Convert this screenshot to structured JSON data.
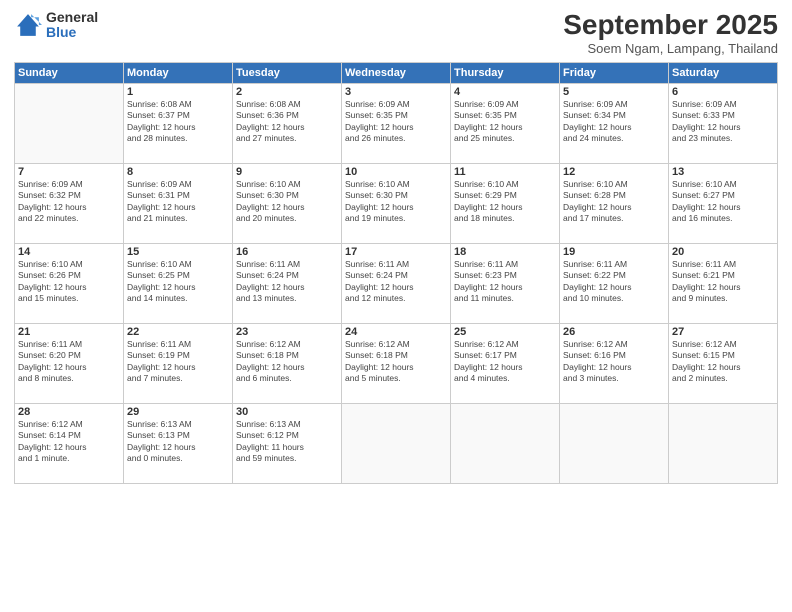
{
  "header": {
    "logo_general": "General",
    "logo_blue": "Blue",
    "title": "September 2025",
    "subtitle": "Soem Ngam, Lampang, Thailand"
  },
  "days_of_week": [
    "Sunday",
    "Monday",
    "Tuesday",
    "Wednesday",
    "Thursday",
    "Friday",
    "Saturday"
  ],
  "weeks": [
    [
      {
        "num": "",
        "info": ""
      },
      {
        "num": "1",
        "info": "Sunrise: 6:08 AM\nSunset: 6:37 PM\nDaylight: 12 hours\nand 28 minutes."
      },
      {
        "num": "2",
        "info": "Sunrise: 6:08 AM\nSunset: 6:36 PM\nDaylight: 12 hours\nand 27 minutes."
      },
      {
        "num": "3",
        "info": "Sunrise: 6:09 AM\nSunset: 6:35 PM\nDaylight: 12 hours\nand 26 minutes."
      },
      {
        "num": "4",
        "info": "Sunrise: 6:09 AM\nSunset: 6:35 PM\nDaylight: 12 hours\nand 25 minutes."
      },
      {
        "num": "5",
        "info": "Sunrise: 6:09 AM\nSunset: 6:34 PM\nDaylight: 12 hours\nand 24 minutes."
      },
      {
        "num": "6",
        "info": "Sunrise: 6:09 AM\nSunset: 6:33 PM\nDaylight: 12 hours\nand 23 minutes."
      }
    ],
    [
      {
        "num": "7",
        "info": "Sunrise: 6:09 AM\nSunset: 6:32 PM\nDaylight: 12 hours\nand 22 minutes."
      },
      {
        "num": "8",
        "info": "Sunrise: 6:09 AM\nSunset: 6:31 PM\nDaylight: 12 hours\nand 21 minutes."
      },
      {
        "num": "9",
        "info": "Sunrise: 6:10 AM\nSunset: 6:30 PM\nDaylight: 12 hours\nand 20 minutes."
      },
      {
        "num": "10",
        "info": "Sunrise: 6:10 AM\nSunset: 6:30 PM\nDaylight: 12 hours\nand 19 minutes."
      },
      {
        "num": "11",
        "info": "Sunrise: 6:10 AM\nSunset: 6:29 PM\nDaylight: 12 hours\nand 18 minutes."
      },
      {
        "num": "12",
        "info": "Sunrise: 6:10 AM\nSunset: 6:28 PM\nDaylight: 12 hours\nand 17 minutes."
      },
      {
        "num": "13",
        "info": "Sunrise: 6:10 AM\nSunset: 6:27 PM\nDaylight: 12 hours\nand 16 minutes."
      }
    ],
    [
      {
        "num": "14",
        "info": "Sunrise: 6:10 AM\nSunset: 6:26 PM\nDaylight: 12 hours\nand 15 minutes."
      },
      {
        "num": "15",
        "info": "Sunrise: 6:10 AM\nSunset: 6:25 PM\nDaylight: 12 hours\nand 14 minutes."
      },
      {
        "num": "16",
        "info": "Sunrise: 6:11 AM\nSunset: 6:24 PM\nDaylight: 12 hours\nand 13 minutes."
      },
      {
        "num": "17",
        "info": "Sunrise: 6:11 AM\nSunset: 6:24 PM\nDaylight: 12 hours\nand 12 minutes."
      },
      {
        "num": "18",
        "info": "Sunrise: 6:11 AM\nSunset: 6:23 PM\nDaylight: 12 hours\nand 11 minutes."
      },
      {
        "num": "19",
        "info": "Sunrise: 6:11 AM\nSunset: 6:22 PM\nDaylight: 12 hours\nand 10 minutes."
      },
      {
        "num": "20",
        "info": "Sunrise: 6:11 AM\nSunset: 6:21 PM\nDaylight: 12 hours\nand 9 minutes."
      }
    ],
    [
      {
        "num": "21",
        "info": "Sunrise: 6:11 AM\nSunset: 6:20 PM\nDaylight: 12 hours\nand 8 minutes."
      },
      {
        "num": "22",
        "info": "Sunrise: 6:11 AM\nSunset: 6:19 PM\nDaylight: 12 hours\nand 7 minutes."
      },
      {
        "num": "23",
        "info": "Sunrise: 6:12 AM\nSunset: 6:18 PM\nDaylight: 12 hours\nand 6 minutes."
      },
      {
        "num": "24",
        "info": "Sunrise: 6:12 AM\nSunset: 6:18 PM\nDaylight: 12 hours\nand 5 minutes."
      },
      {
        "num": "25",
        "info": "Sunrise: 6:12 AM\nSunset: 6:17 PM\nDaylight: 12 hours\nand 4 minutes."
      },
      {
        "num": "26",
        "info": "Sunrise: 6:12 AM\nSunset: 6:16 PM\nDaylight: 12 hours\nand 3 minutes."
      },
      {
        "num": "27",
        "info": "Sunrise: 6:12 AM\nSunset: 6:15 PM\nDaylight: 12 hours\nand 2 minutes."
      }
    ],
    [
      {
        "num": "28",
        "info": "Sunrise: 6:12 AM\nSunset: 6:14 PM\nDaylight: 12 hours\nand 1 minute."
      },
      {
        "num": "29",
        "info": "Sunrise: 6:13 AM\nSunset: 6:13 PM\nDaylight: 12 hours\nand 0 minutes."
      },
      {
        "num": "30",
        "info": "Sunrise: 6:13 AM\nSunset: 6:12 PM\nDaylight: 11 hours\nand 59 minutes."
      },
      {
        "num": "",
        "info": ""
      },
      {
        "num": "",
        "info": ""
      },
      {
        "num": "",
        "info": ""
      },
      {
        "num": "",
        "info": ""
      }
    ]
  ]
}
